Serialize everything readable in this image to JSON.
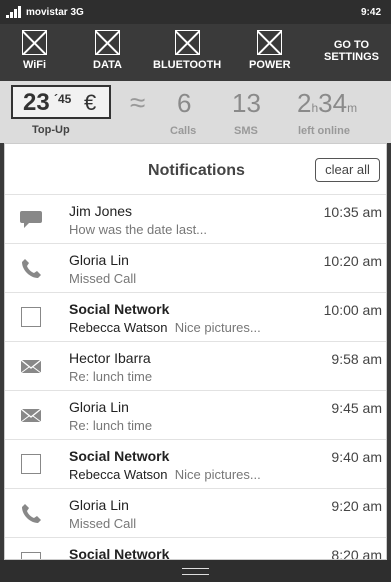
{
  "status": {
    "carrier": "movistar 3G",
    "time": "9:42"
  },
  "toggles": [
    {
      "label": "WiFi",
      "icon": "wifi-toggle-icon"
    },
    {
      "label": "DATA",
      "icon": "data-toggle-icon"
    },
    {
      "label": "BLUETOOTH",
      "icon": "bluetooth-toggle-icon"
    },
    {
      "label": "POWER",
      "icon": "power-toggle-icon"
    }
  ],
  "goto_settings": {
    "line1": "GO TO",
    "line2": "SETTINGS"
  },
  "summary": {
    "balance_int": "23",
    "balance_cents": "´45",
    "currency": "€",
    "topup_label": "Top-Up",
    "approx": "≈",
    "calls_value": "6",
    "calls_label": "Calls",
    "sms_value": "13",
    "sms_label": "SMS",
    "online_hours": "2",
    "online_h_unit": "h",
    "online_minutes": "34",
    "online_m_unit": "m",
    "online_label": "left online"
  },
  "notifications": {
    "title": "Notifications",
    "clear_label": "clear all",
    "items": [
      {
        "type": "chat",
        "icon": "chat-bubble-icon",
        "title": "Jim Jones",
        "title_bold": false,
        "sender": "",
        "text": "How was the date last...",
        "time": "10:35 am"
      },
      {
        "type": "call",
        "icon": "phone-icon",
        "title": "Gloria Lin",
        "title_bold": false,
        "sender": "",
        "text": "Missed Call",
        "time": "10:20 am"
      },
      {
        "type": "social",
        "icon": "social-network-icon",
        "title": "Social Network",
        "title_bold": true,
        "sender": "Rebecca Watson",
        "text": "Nice pictures...",
        "time": "10:00 am"
      },
      {
        "type": "mail",
        "icon": "envelope-icon",
        "title": "Hector Ibarra",
        "title_bold": false,
        "sender": "",
        "text": "Re: lunch time",
        "time": "9:58 am"
      },
      {
        "type": "mail",
        "icon": "envelope-icon",
        "title": "Gloria Lin",
        "title_bold": false,
        "sender": "",
        "text": "Re: lunch time",
        "time": "9:45 am"
      },
      {
        "type": "social",
        "icon": "social-network-icon",
        "title": "Social Network",
        "title_bold": true,
        "sender": "Rebecca Watson",
        "text": "Nice pictures...",
        "time": "9:40 am"
      },
      {
        "type": "call",
        "icon": "phone-icon",
        "title": "Gloria Lin",
        "title_bold": false,
        "sender": "",
        "text": "Missed Call",
        "time": "9:20 am"
      },
      {
        "type": "social",
        "icon": "social-network-icon",
        "title": "Social Network",
        "title_bold": true,
        "sender": "",
        "text": "",
        "time": "8:20 am"
      }
    ]
  },
  "colors": {
    "statusbar": "#2e2e2e",
    "toggles_bg": "#3a3a3a",
    "summary_bg": "#dcdcdc",
    "panel_bg": "#ffffff"
  }
}
